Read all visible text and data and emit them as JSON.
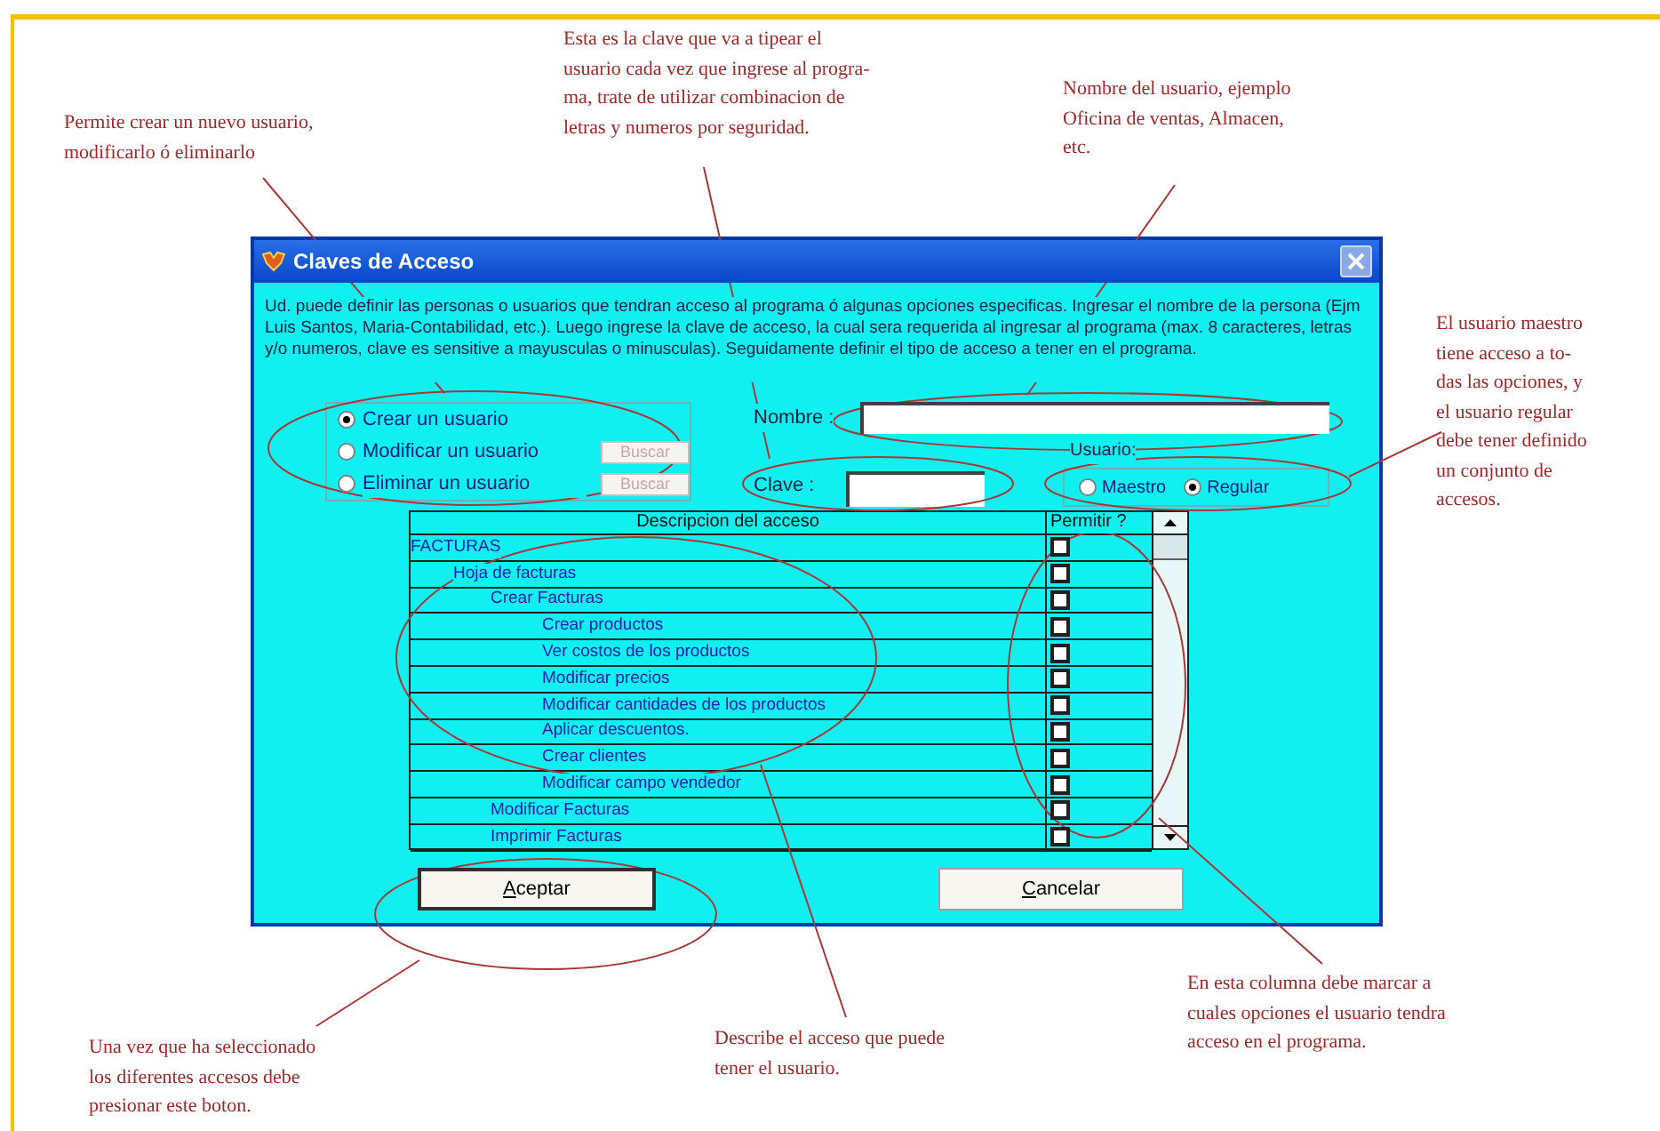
{
  "annotations": [
    {
      "kind": "note",
      "lines": [
        "Permite crear un nuevo usuario,",
        "modificarlo ó eliminarlo"
      ]
    },
    {
      "kind": "note",
      "lines": [
        "Esta es la clave que va a tipear el",
        "usuario cada vez que ingrese al progra-",
        "ma, trate de utilizar combinacion de",
        "letras y numeros por seguridad."
      ]
    },
    {
      "kind": "note",
      "lines": [
        "Nombre del usuario, ejemplo",
        "Oficina de ventas, Almacen,",
        "etc."
      ]
    },
    {
      "kind": "note",
      "lines": [
        "El usuario maestro",
        "tiene acceso a to-",
        "das las opciones, y",
        "el usuario regular",
        "debe tener definido",
        "un conjunto de",
        "accesos."
      ]
    },
    {
      "kind": "note",
      "lines": [
        "Una vez que ha seleccionado",
        "los diferentes accesos debe",
        "presionar este boton."
      ]
    },
    {
      "kind": "note",
      "lines": [
        "Describe el acceso que puede",
        "tener el usuario."
      ]
    },
    {
      "kind": "note",
      "lines": [
        "En esta columna debe marcar a",
        "cuales opciones el usuario tendra",
        "acceso en el programa."
      ]
    }
  ],
  "dialog": {
    "title": "Claves de Acceso",
    "intro": "Ud. puede definir las personas o usuarios que tendran acceso al programa ó algunas opciones especificas. Ingresar el nombre de la persona (Ejm Luis Santos, Maria-Contabilidad, etc.). Luego ingrese la clave de acceso, la cual sera requerida al ingresar al programa (max. 8 caracteres, letras y/o numeros, clave es sensitive a mayusculas o minusculas). Seguidamente definir el tipo de acceso a tener en el programa.",
    "actions": [
      {
        "label": "Crear un usuario",
        "selected": true
      },
      {
        "label": "Modificar un usuario",
        "selected": false,
        "search_button": {
          "label": "Buscar",
          "disabled": true
        }
      },
      {
        "label": "Eliminar un usuario",
        "selected": false,
        "search_button": {
          "label": "Buscar",
          "disabled": true
        }
      }
    ],
    "name_field": {
      "label": "Nombre :"
    },
    "key_field": {
      "label": "Clave :"
    },
    "user_type": {
      "label": "Usuario:",
      "options": [
        {
          "label": "Maestro",
          "selected": false
        },
        {
          "label": "Regular",
          "selected": true
        }
      ]
    },
    "table": {
      "columns": [
        "Descripcion del acceso",
        "Permitir ?"
      ],
      "rows": [
        {
          "label": "FACTURAS",
          "checked": false,
          "children": [
            {
              "label": "Hoja de  facturas",
              "checked": false,
              "children": [
                {
                  "label": "Crear Facturas",
                  "checked": false,
                  "children": [
                    {
                      "label": "Crear productos",
                      "checked": false
                    },
                    {
                      "label": "Ver costos de los productos",
                      "checked": false
                    },
                    {
                      "label": "Modificar precios",
                      "checked": false
                    },
                    {
                      "label": "Modificar cantidades de los productos",
                      "checked": false
                    },
                    {
                      "label": "Aplicar descuentos.",
                      "checked": false
                    },
                    {
                      "label": "Crear clientes",
                      "checked": false
                    },
                    {
                      "label": "Modificar campo vendedor",
                      "checked": false
                    }
                  ]
                },
                {
                  "label": "Modificar Facturas",
                  "checked": false
                },
                {
                  "label": "Imprimir Facturas",
                  "checked": false
                }
              ]
            }
          ]
        }
      ]
    },
    "buttons": [
      {
        "label": "Aceptar",
        "default": true
      },
      {
        "label": "Cancelar",
        "default": false
      }
    ]
  }
}
